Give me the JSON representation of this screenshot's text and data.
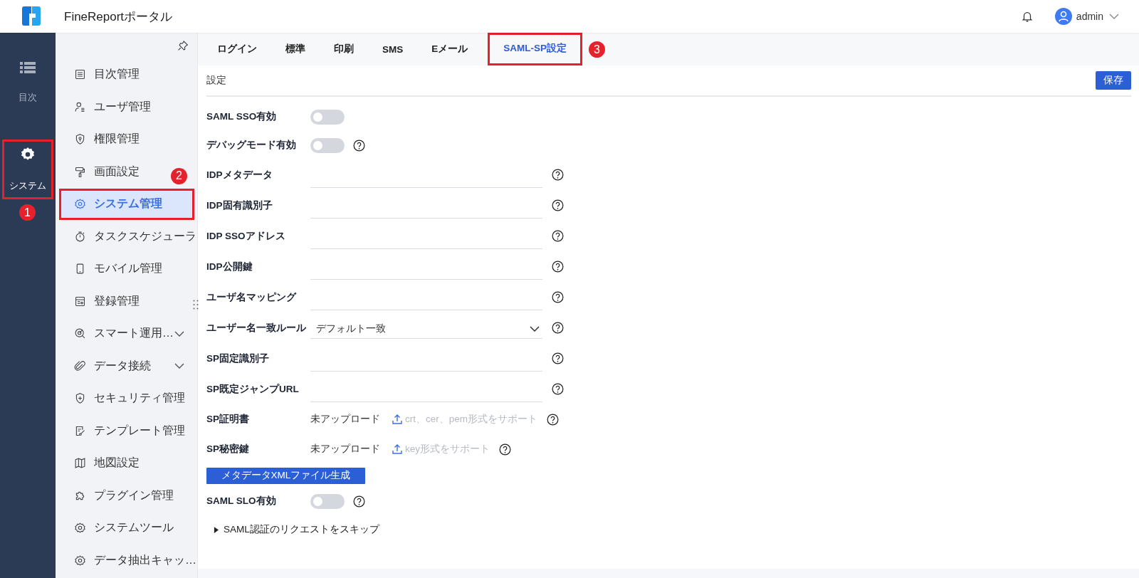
{
  "header": {
    "title": "FineReportポータル",
    "user": "admin"
  },
  "rail": [
    {
      "label": "目次",
      "selected": false
    },
    {
      "label": "システム",
      "selected": true,
      "annotation": "1"
    }
  ],
  "sidebar": {
    "items": [
      {
        "label": "目次管理",
        "selected": false
      },
      {
        "label": "ユーザ管理",
        "selected": false
      },
      {
        "label": "権限管理",
        "selected": false
      },
      {
        "label": "画面設定",
        "selected": false
      },
      {
        "label": "システム管理",
        "selected": true,
        "annotation": "2"
      },
      {
        "label": "タスクスケジューラ",
        "selected": false
      },
      {
        "label": "モバイル管理",
        "selected": false
      },
      {
        "label": "登録管理",
        "selected": false
      },
      {
        "label": "スマート運用…",
        "selected": false,
        "expanded": false
      },
      {
        "label": "データ接続",
        "selected": false,
        "expanded": false
      },
      {
        "label": "セキュリティ管理",
        "selected": false
      },
      {
        "label": "テンプレート管理",
        "selected": false
      },
      {
        "label": "地図設定",
        "selected": false
      },
      {
        "label": "プラグイン管理",
        "selected": false
      },
      {
        "label": "システムツール",
        "selected": false
      },
      {
        "label": "データ抽出キャッ…",
        "selected": false
      }
    ]
  },
  "tabs": [
    {
      "label": "ログイン",
      "selected": false
    },
    {
      "label": "標準",
      "selected": false
    },
    {
      "label": "印刷",
      "selected": false
    },
    {
      "label": "SMS",
      "selected": false
    },
    {
      "label": "Eメール",
      "selected": false
    },
    {
      "label": "SAML-SP設定",
      "selected": true,
      "annotation": "3"
    }
  ],
  "section": {
    "title": "設定",
    "save_button": "保存"
  },
  "form": [
    {
      "kind": "toggle",
      "label": "SAML SSO有効",
      "on": false,
      "help": false
    },
    {
      "kind": "toggle",
      "label": "デバッグモード有効",
      "on": false,
      "help": true
    },
    {
      "kind": "text",
      "label": "IDPメタデータ",
      "help": true
    },
    {
      "kind": "text",
      "label": "IDP固有識別子",
      "help": true
    },
    {
      "kind": "text",
      "label": "IDP SSOアドレス",
      "help": true
    },
    {
      "kind": "text",
      "label": "IDP公開鍵",
      "help": true
    },
    {
      "kind": "text",
      "label": "ユーザ名マッピング",
      "help": true
    },
    {
      "kind": "select",
      "label": "ユーザー名一致ルール",
      "value": "デフォルト一致",
      "help": true
    },
    {
      "kind": "text",
      "label": "SP固定識別子",
      "help": true
    },
    {
      "kind": "text",
      "label": "SP既定ジャンプURL",
      "help": true
    },
    {
      "kind": "upload",
      "label": "SP証明書",
      "status": "未アップロード",
      "hint": "crt、cer、pem形式をサポート",
      "help": true
    },
    {
      "kind": "upload",
      "label": "SP秘密鍵",
      "status": "未アップロード",
      "hint": "key形式をサポート",
      "help": true
    },
    {
      "kind": "button",
      "label": "メタデータXMLファイル生成"
    },
    {
      "kind": "toggle",
      "label": "SAML SLO有効",
      "on": false,
      "help": true
    },
    {
      "kind": "collapsible",
      "label": "SAML認証のリクエストをスキップ",
      "expanded": false
    }
  ]
}
